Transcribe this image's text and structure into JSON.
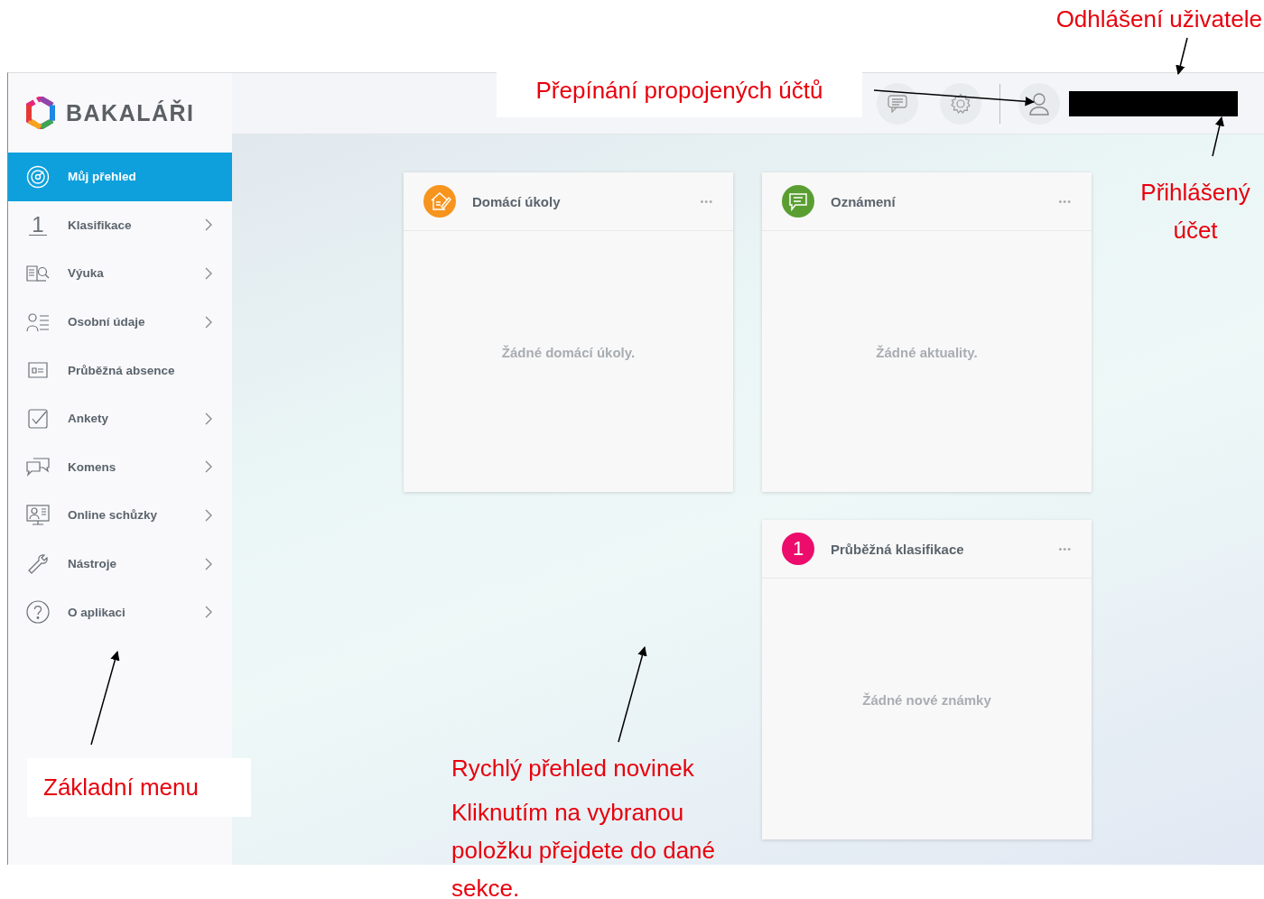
{
  "app": {
    "logo_text": "BAKALÁŘI"
  },
  "sidebar": {
    "items": [
      {
        "label": "Můj přehled",
        "selected": true,
        "has_submenu": false
      },
      {
        "label": "Klasifikace",
        "selected": false,
        "has_submenu": true,
        "icon_text": "1"
      },
      {
        "label": "Výuka",
        "selected": false,
        "has_submenu": true
      },
      {
        "label": "Osobní údaje",
        "selected": false,
        "has_submenu": true
      },
      {
        "label": "Průběžná absence",
        "selected": false,
        "has_submenu": false
      },
      {
        "label": "Ankety",
        "selected": false,
        "has_submenu": true
      },
      {
        "label": "Komens",
        "selected": false,
        "has_submenu": true
      },
      {
        "label": "Online schůzky",
        "selected": false,
        "has_submenu": true
      },
      {
        "label": "Nástroje",
        "selected": false,
        "has_submenu": true
      },
      {
        "label": "O aplikaci",
        "selected": false,
        "has_submenu": true
      }
    ]
  },
  "header": {
    "user_name_redacted": true
  },
  "cards": [
    {
      "title": "Domácí úkoly",
      "color": "#f7941d",
      "empty_text": "Žádné domácí úkoly.",
      "menu": "•••"
    },
    {
      "title": "Oznámení",
      "color": "#5a9e32",
      "empty_text": "Žádné aktuality.",
      "menu": "•••"
    },
    {
      "title": "Průběžná klasifikace",
      "color": "#ec0c6c",
      "icon_text": "1",
      "empty_text": "Žádné nové známky",
      "menu": "•••"
    }
  ],
  "annotations": [
    {
      "kind": "boxed",
      "text": "Přepínání propojených účtů"
    },
    {
      "kind": "plain",
      "text": "Odhlášení uživatele"
    },
    {
      "kind": "plain",
      "text": "Přihlášený účet"
    },
    {
      "kind": "boxed",
      "text": "Základní menu"
    },
    {
      "kind": "plain",
      "text": "Rychlý přehled novinek"
    },
    {
      "kind": "plain",
      "text": "Kliknutím na vybranou položku přejdete do dané sekce."
    }
  ]
}
